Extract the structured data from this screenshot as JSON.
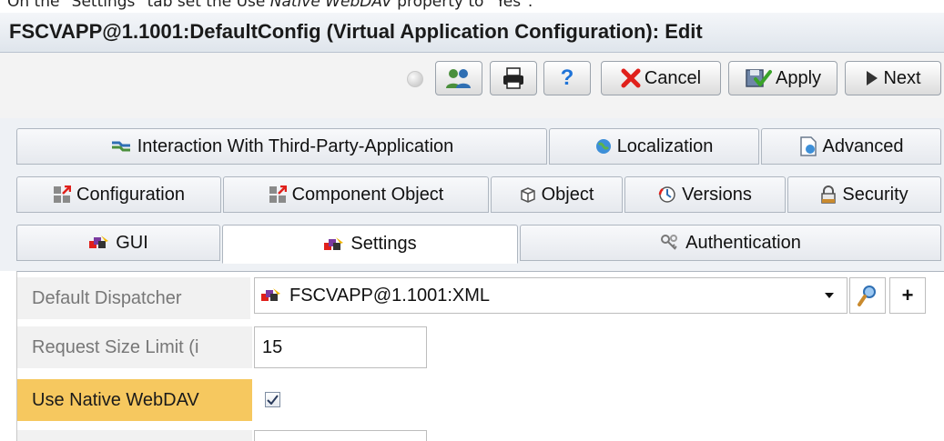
{
  "caption": {
    "prefix": "On the \"Settings\" tab set the Use ",
    "emphasis": "Native WebDAV",
    "suffix": " property to \"Yes\"."
  },
  "window": {
    "title": "FSCVAPP@1.1001:DefaultConfig (Virtual Application Configuration): Edit"
  },
  "toolbar": {
    "cancel_label": "Cancel",
    "apply_label": "Apply",
    "next_label": "Next",
    "help_label": "?"
  },
  "tabs": {
    "row1": [
      {
        "label": "Interaction With Third-Party-Application",
        "icon": "handshake-icon"
      },
      {
        "label": "Localization",
        "icon": "globe-icon"
      },
      {
        "label": "Advanced",
        "icon": "document-user-icon"
      }
    ],
    "row2": [
      {
        "label": "Configuration",
        "icon": "configuration-icon"
      },
      {
        "label": "Component Object",
        "icon": "component-object-icon"
      },
      {
        "label": "Object",
        "icon": "cube-icon"
      },
      {
        "label": "Versions",
        "icon": "versions-icon"
      },
      {
        "label": "Security",
        "icon": "lock-icon"
      }
    ],
    "row3": [
      {
        "label": "GUI",
        "icon": "app-icon"
      },
      {
        "label": "Settings",
        "icon": "app-icon",
        "active": true
      },
      {
        "label": "Authentication",
        "icon": "keys-icon"
      }
    ]
  },
  "fields": {
    "default_dispatcher": {
      "label": "Default Dispatcher",
      "value": "FSCVAPP@1.1001:XML"
    },
    "request_size_limit": {
      "label": "Request Size Limit (i",
      "value": "15"
    },
    "use_native_webdav": {
      "label": "Use Native WebDAV",
      "checked": true
    }
  },
  "colors": {
    "highlight": "#f6c85f",
    "cancel_x": "#e0201b",
    "apply_check": "#3aa329",
    "help": "#1e73d8"
  }
}
